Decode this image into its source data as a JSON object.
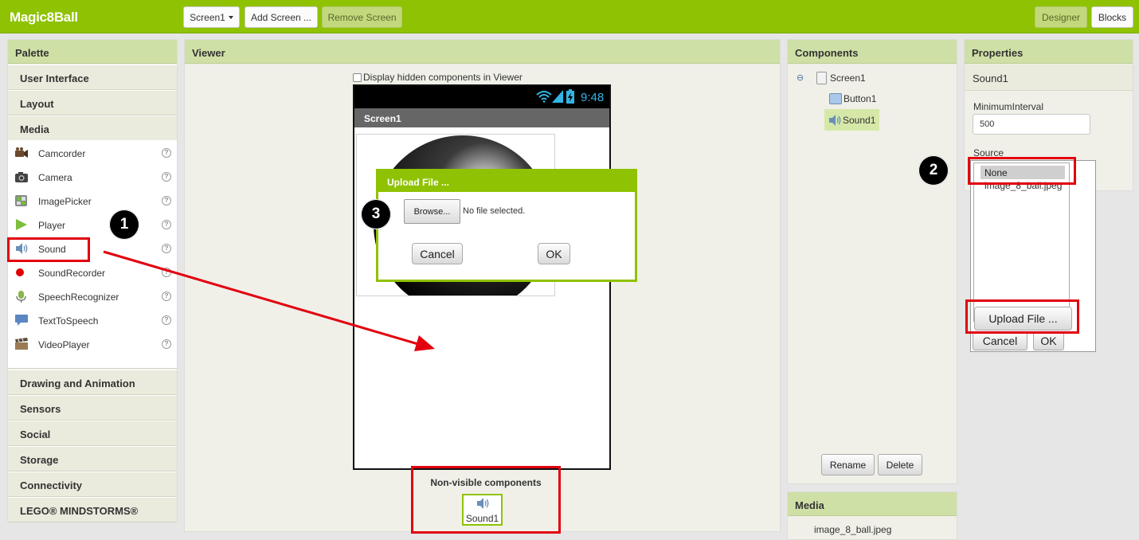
{
  "topbar": {
    "title": "Magic8Ball",
    "screen_dropdown": "Screen1",
    "add_screen": "Add Screen ...",
    "remove_screen": "Remove Screen",
    "designer": "Designer",
    "blocks": "Blocks"
  },
  "palette": {
    "title": "Palette",
    "categories_top": [
      "User Interface",
      "Layout",
      "Media"
    ],
    "media_items": [
      {
        "label": "Camcorder",
        "icon": "camcorder-icon"
      },
      {
        "label": "Camera",
        "icon": "camera-icon"
      },
      {
        "label": "ImagePicker",
        "icon": "image-picker-icon"
      },
      {
        "label": "Player",
        "icon": "player-icon"
      },
      {
        "label": "Sound",
        "icon": "sound-icon"
      },
      {
        "label": "SoundRecorder",
        "icon": "sound-recorder-icon"
      },
      {
        "label": "SpeechRecognizer",
        "icon": "speech-recognizer-icon"
      },
      {
        "label": "TextToSpeech",
        "icon": "text-to-speech-icon"
      },
      {
        "label": "VideoPlayer",
        "icon": "video-player-icon"
      }
    ],
    "categories_bottom": [
      "Drawing and Animation",
      "Sensors",
      "Social",
      "Storage",
      "Connectivity",
      "LEGO® MINDSTORMS®"
    ],
    "help_glyph": "?"
  },
  "viewer": {
    "title": "Viewer",
    "hidden_checkbox_label": "Display hidden components in Viewer",
    "phone_time": "9:48",
    "screen_title": "Screen1",
    "non_visible_title": "Non-visible components",
    "non_visible_item": "Sound1"
  },
  "upload_dialog": {
    "title": "Upload File ...",
    "browse": "Browse...",
    "no_file": "No file selected.",
    "cancel": "Cancel",
    "ok": "OK"
  },
  "components": {
    "title": "Components",
    "collapse_glyph": "⊖",
    "tree": [
      "Screen1",
      "Button1",
      "Sound1"
    ],
    "rename": "Rename",
    "delete": "Delete"
  },
  "media_panel": {
    "title": "Media",
    "items": [
      "image_8_ball.jpeg"
    ]
  },
  "properties": {
    "title": "Properties",
    "component": "Sound1",
    "min_interval_label": "MinimumInterval",
    "min_interval_value": "500",
    "source_label": "Source",
    "source_options": [
      "None",
      "image_8_ball.jpeg"
    ],
    "upload": "Upload File ...",
    "cancel": "Cancel",
    "ok": "OK"
  },
  "annotations": [
    "1",
    "2",
    "3"
  ],
  "colors": {
    "accent": "#8fc202",
    "annotation_red": "#e2000f"
  }
}
